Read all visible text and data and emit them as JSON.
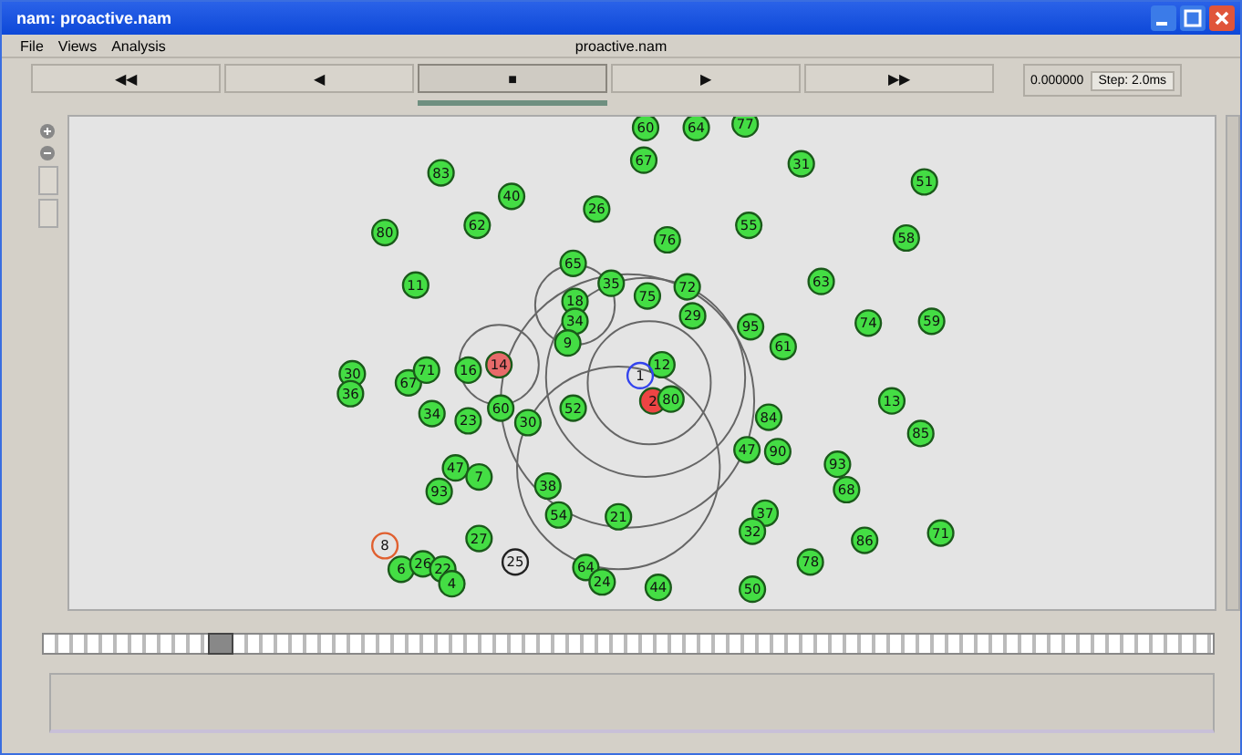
{
  "window": {
    "title": "nam: proactive.nam"
  },
  "menu": {
    "items": [
      "File",
      "Views",
      "Analysis"
    ],
    "file_name": "proactive.nam"
  },
  "controls": [
    {
      "label": "◀◀",
      "selected": false
    },
    {
      "label": "◀",
      "selected": false
    },
    {
      "label": "■",
      "selected": true
    },
    {
      "label": "▶",
      "selected": false
    },
    {
      "label": "▶▶",
      "selected": false
    }
  ],
  "time": "0.000000",
  "step": "Step: 2.0ms",
  "nodes": [
    {
      "label": "60",
      "kind": "filled",
      "color": "#44dd44"
    },
    {
      "label": "64",
      "kind": "filled",
      "color": "#44dd44"
    },
    {
      "label": "77",
      "kind": "filled",
      "color": "#44dd44"
    },
    {
      "label": "83",
      "kind": "filled",
      "color": "#44dd44"
    },
    {
      "label": "40",
      "kind": "filled",
      "color": "#44dd44"
    },
    {
      "label": "26",
      "kind": "filled",
      "color": "#44dd44"
    },
    {
      "label": "67",
      "kind": "filled",
      "color": "#44dd44"
    },
    {
      "label": "31",
      "kind": "filled",
      "color": "#44dd44"
    },
    {
      "label": "51",
      "kind": "filled",
      "color": "#44dd44"
    },
    {
      "label": "80",
      "kind": "filled",
      "color": "#44dd44"
    },
    {
      "label": "62",
      "kind": "filled",
      "color": "#44dd44"
    },
    {
      "label": "11",
      "kind": "filled",
      "color": "#44dd44"
    },
    {
      "label": "76",
      "kind": "filled",
      "color": "#44dd44"
    },
    {
      "label": "55",
      "kind": "filled",
      "color": "#44dd44"
    },
    {
      "label": "58",
      "kind": "filled",
      "color": "#44dd44"
    },
    {
      "label": "65",
      "kind": "filled",
      "color": "#44dd44"
    },
    {
      "label": "35",
      "kind": "filled",
      "color": "#44dd44"
    },
    {
      "label": "75",
      "kind": "filled",
      "color": "#44dd44"
    },
    {
      "label": "72",
      "kind": "filled",
      "color": "#44dd44"
    },
    {
      "label": "18",
      "kind": "filled",
      "color": "#44dd44"
    },
    {
      "label": "34",
      "kind": "filled",
      "color": "#44dd44"
    },
    {
      "label": "29",
      "kind": "filled",
      "color": "#44dd44"
    },
    {
      "label": "63",
      "kind": "filled",
      "color": "#44dd44"
    },
    {
      "label": "74",
      "kind": "filled",
      "color": "#44dd44"
    },
    {
      "label": "59",
      "kind": "filled",
      "color": "#44dd44"
    },
    {
      "label": "95",
      "kind": "filled",
      "color": "#44dd44"
    },
    {
      "label": "61",
      "kind": "filled",
      "color": "#44dd44"
    },
    {
      "label": "9",
      "kind": "filled",
      "color": "#44dd44"
    },
    {
      "label": "30",
      "kind": "filled",
      "color": "#44dd44"
    },
    {
      "label": "36",
      "kind": "filled",
      "color": "#44dd44"
    },
    {
      "label": "67",
      "kind": "filled",
      "color": "#44dd44"
    },
    {
      "label": "71",
      "kind": "filled",
      "color": "#44dd44"
    },
    {
      "label": "16",
      "kind": "filled",
      "color": "#44dd44"
    },
    {
      "label": "14",
      "kind": "filled",
      "color": "#e86a6a"
    },
    {
      "label": "12",
      "kind": "filled",
      "color": "#44dd44"
    },
    {
      "label": "1",
      "kind": "ring",
      "color": "#3344ee"
    },
    {
      "label": "2",
      "kind": "filled",
      "color": "#ee4444"
    },
    {
      "label": "80",
      "kind": "filled",
      "color": "#44dd44"
    },
    {
      "label": "60",
      "kind": "filled",
      "color": "#44dd44"
    },
    {
      "label": "30",
      "kind": "filled",
      "color": "#44dd44"
    },
    {
      "label": "52",
      "kind": "filled",
      "color": "#44dd44"
    },
    {
      "label": "34",
      "kind": "filled",
      "color": "#44dd44"
    },
    {
      "label": "23",
      "kind": "filled",
      "color": "#44dd44"
    },
    {
      "label": "84",
      "kind": "filled",
      "color": "#44dd44"
    },
    {
      "label": "13",
      "kind": "filled",
      "color": "#44dd44"
    },
    {
      "label": "85",
      "kind": "filled",
      "color": "#44dd44"
    },
    {
      "label": "47",
      "kind": "filled",
      "color": "#44dd44"
    },
    {
      "label": "90",
      "kind": "filled",
      "color": "#44dd44"
    },
    {
      "label": "93",
      "kind": "filled",
      "color": "#44dd44"
    },
    {
      "label": "68",
      "kind": "filled",
      "color": "#44dd44"
    },
    {
      "label": "47",
      "kind": "filled",
      "color": "#44dd44"
    },
    {
      "label": "7",
      "kind": "filled",
      "color": "#44dd44"
    },
    {
      "label": "93",
      "kind": "filled",
      "color": "#44dd44"
    },
    {
      "label": "38",
      "kind": "filled",
      "color": "#44dd44"
    },
    {
      "label": "54",
      "kind": "filled",
      "color": "#44dd44"
    },
    {
      "label": "21",
      "kind": "filled",
      "color": "#44dd44"
    },
    {
      "label": "37",
      "kind": "filled",
      "color": "#44dd44"
    },
    {
      "label": "32",
      "kind": "filled",
      "color": "#44dd44"
    },
    {
      "label": "27",
      "kind": "filled",
      "color": "#44dd44"
    },
    {
      "label": "8",
      "kind": "ring",
      "color": "#e06030"
    },
    {
      "label": "86",
      "kind": "filled",
      "color": "#44dd44"
    },
    {
      "label": "71",
      "kind": "filled",
      "color": "#44dd44"
    },
    {
      "label": "25",
      "kind": "ring",
      "color": "#222222"
    },
    {
      "label": "6",
      "kind": "filled",
      "color": "#44dd44"
    },
    {
      "label": "26",
      "kind": "filled",
      "color": "#44dd44"
    },
    {
      "label": "22",
      "kind": "filled",
      "color": "#44dd44"
    },
    {
      "label": "4",
      "kind": "filled",
      "color": "#44dd44"
    },
    {
      "label": "78",
      "kind": "filled",
      "color": "#44dd44"
    },
    {
      "label": "64",
      "kind": "filled",
      "color": "#44dd44"
    },
    {
      "label": "24",
      "kind": "filled",
      "color": "#44dd44"
    },
    {
      "label": "44",
      "kind": "filled",
      "color": "#44dd44"
    },
    {
      "label": "50",
      "kind": "filled",
      "color": "#44dd44"
    }
  ],
  "timeline": {
    "level": 0.15
  }
}
